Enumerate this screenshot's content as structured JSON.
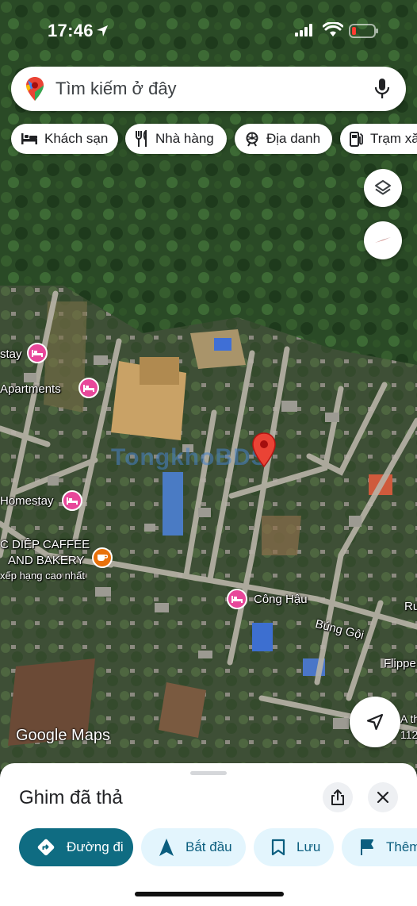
{
  "status_bar": {
    "time": "17:46"
  },
  "search": {
    "placeholder": "Tìm kiếm ở đây"
  },
  "chips": [
    {
      "label": "Khách sạn",
      "icon": "hotel-icon"
    },
    {
      "label": "Nhà hàng",
      "icon": "restaurant-icon"
    },
    {
      "label": "Địa danh",
      "icon": "landmark-icon"
    },
    {
      "label": "Trạm xă",
      "icon": "gas-station-icon"
    }
  ],
  "map": {
    "labels": {
      "stay": "stay",
      "apartments": "Apartments",
      "homestay": "Homestay",
      "cafe_line1": "C DIỆP CAFFEE",
      "cafe_line2": "AND BAKERY",
      "cafe_rating": "xếp hạng cao nhất",
      "cong_hau": "Công Hậu",
      "road": "Búng Gội",
      "flippe": "Flippe",
      "ru": "Ru",
      "a_th": "A th",
      "num": "112",
      "attribution": "Google Maps",
      "watermark": "TongkhoBDS"
    },
    "colors": {
      "poi_hotel": "#e8479a",
      "poi_cafe": "#e8710a",
      "pin": "#ea4335"
    }
  },
  "sheet": {
    "title": "Ghim đã thả",
    "actions": [
      {
        "label": "Đường đi",
        "icon": "directions-icon"
      },
      {
        "label": "Bắt đầu",
        "icon": "navigation-arrow-icon"
      },
      {
        "label": "Lưu",
        "icon": "bookmark-icon"
      },
      {
        "label": "Thêm",
        "icon": "flag-icon"
      }
    ]
  }
}
